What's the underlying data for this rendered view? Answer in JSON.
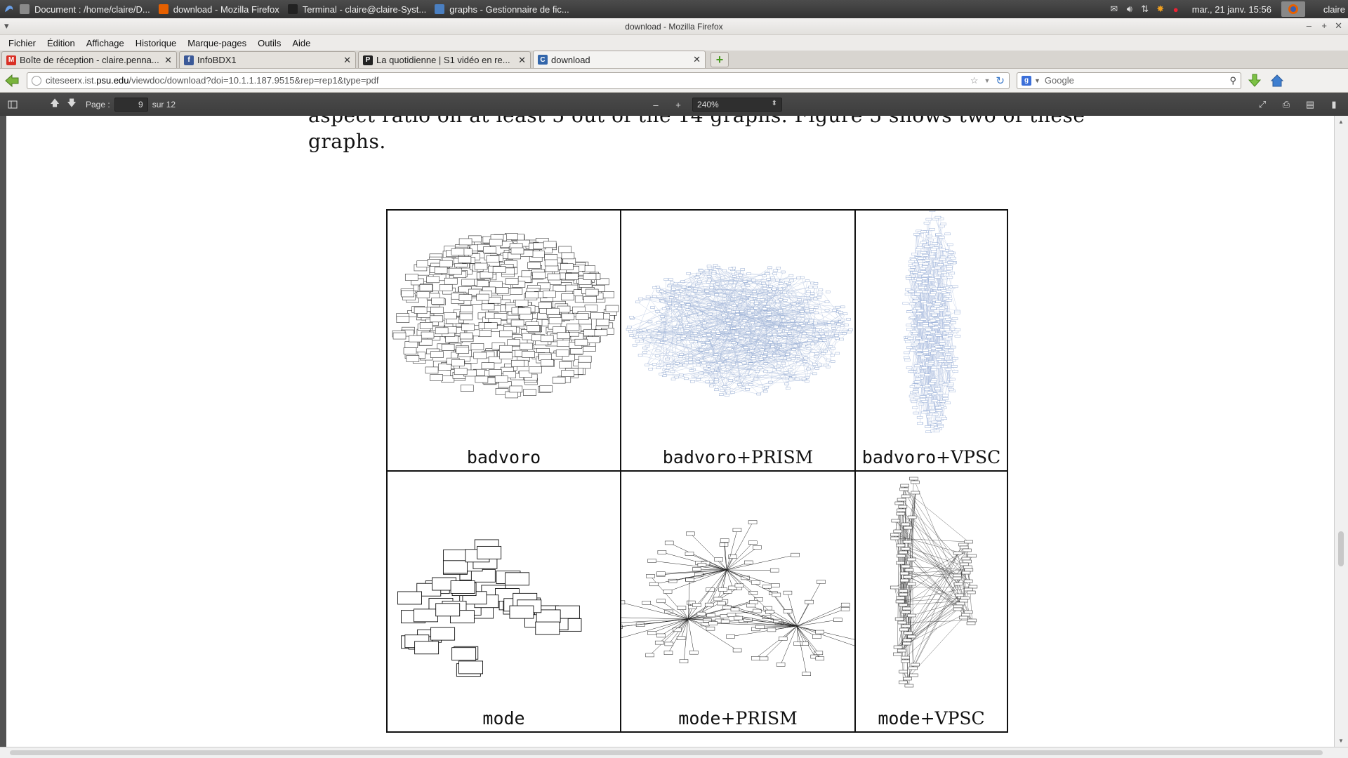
{
  "system_panel": {
    "tasks": [
      {
        "title": "Document : /home/claire/D...",
        "icon": "document-icon",
        "color": "#8a8a8a"
      },
      {
        "title": "download - Mozilla Firefox",
        "icon": "firefox-icon",
        "color": "#e66000"
      },
      {
        "title": "Terminal - claire@claire-Syst...",
        "icon": "terminal-icon",
        "color": "#222222"
      },
      {
        "title": "graphs - Gestionnaire de fic...",
        "icon": "folder-icon",
        "color": "#4a7fc1"
      }
    ],
    "clock": "mar., 21 janv.  15:56",
    "user": "claire"
  },
  "window": {
    "title": "download - Mozilla Firefox"
  },
  "menubar": [
    "Fichier",
    "Édition",
    "Affichage",
    "Historique",
    "Marque-pages",
    "Outils",
    "Aide"
  ],
  "tabs": [
    {
      "label": "Boîte de réception - claire.penna...",
      "icon": "gmail-icon",
      "color": "#d93025",
      "glyph": "M"
    },
    {
      "label": "InfoBDX1",
      "icon": "facebook-icon",
      "color": "#3b5998",
      "glyph": "f"
    },
    {
      "label": "La quotidienne | S1 vidéo en re...",
      "icon": "video-site-icon",
      "color": "#222222",
      "glyph": "P"
    },
    {
      "label": "download",
      "icon": "citeseer-icon",
      "color": "#3366aa",
      "glyph": "C",
      "active": true
    }
  ],
  "navbar": {
    "url_prefix": "citeseerx.ist.",
    "url_domain": "psu.edu",
    "url_path": "/viewdoc/download?doi=10.1.1.187.9515&rep=rep1&type=pdf",
    "search_placeholder": "Google"
  },
  "pdf_toolbar": {
    "page_label": "Page :",
    "page_value": "9",
    "page_total": "sur 12",
    "zoom_value": "240%"
  },
  "document": {
    "line1": "aspect ratio on at least 5 out of the 14 graphs. Figure 5 shows two of these",
    "line2": "graphs.",
    "figure_cells": [
      {
        "caption": "badvoro",
        "suffix": ""
      },
      {
        "caption": "badvoro",
        "suffix": "+PRISM"
      },
      {
        "caption": "badvoro",
        "suffix": "+VPSC"
      },
      {
        "caption": "mode",
        "suffix": ""
      },
      {
        "caption": "mode",
        "suffix": "+PRISM"
      },
      {
        "caption": "mode",
        "suffix": "+VPSC"
      }
    ]
  }
}
